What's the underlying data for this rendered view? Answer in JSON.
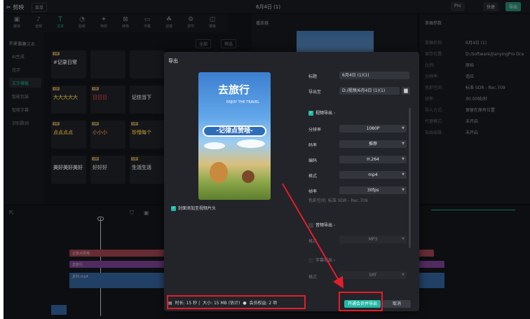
{
  "app": {
    "logo": "剪映",
    "menu_label": "菜单",
    "project_title": "6月4日 (1)",
    "pro_label": "Pro",
    "shortcut_label": "快捷",
    "export_label": "导出"
  },
  "media_tabs": [
    {
      "icon": "▣",
      "label": "媒体",
      "icon_name": "media-icon"
    },
    {
      "icon": "♪",
      "label": "音频",
      "icon_name": "audio-icon"
    },
    {
      "icon": "T",
      "label": "文本",
      "icon_name": "text-icon"
    },
    {
      "icon": "◔",
      "label": "贴纸",
      "icon_name": "sticker-icon"
    },
    {
      "icon": "✦",
      "label": "特效",
      "icon_name": "effect-icon"
    },
    {
      "icon": "⊠",
      "label": "转场",
      "icon_name": "transition-icon"
    },
    {
      "icon": "▭",
      "label": "字幕",
      "icon_name": "caption-icon"
    },
    {
      "icon": "☘",
      "label": "滤镜",
      "icon_name": "filter-icon"
    },
    {
      "icon": "⚙",
      "label": "调节",
      "icon_name": "adjust-icon"
    },
    {
      "icon": "◫",
      "label": "模板",
      "icon_name": "template-icon"
    }
  ],
  "categories": [
    "新建文本",
    "AI生成",
    "花字",
    "文字模板",
    "智能包装",
    "智能字幕",
    "识别歌词"
  ],
  "asset_panel": {
    "search": "< 新建文本",
    "filter_all": "全部",
    "filter_label": "筛选"
  },
  "assets": [
    {
      "text": "#记录日常",
      "color": "#e8eaee",
      "vip": "VIP"
    },
    {
      "text": "",
      "color": "#e8eaee",
      "vip": ""
    },
    {
      "text": "",
      "color": "#e8eaee",
      "vip": ""
    },
    {
      "text": "大大大大大",
      "color": "#f0d24a",
      "vip": "VIP"
    },
    {
      "text": "日日日",
      "color": "#f0424a",
      "vip": "VIP"
    },
    {
      "text": "记住当下",
      "color": "#e8eaee",
      "vip": ""
    },
    {
      "text": "点点点点",
      "color": "#f0c24a",
      "vip": "VIP"
    },
    {
      "text": "小小小",
      "color": "#f0904a",
      "vip": "VIP"
    },
    {
      "text": "珍惜每个",
      "color": "#f0c24a",
      "vip": "VIP"
    },
    {
      "text": "美好美好美好",
      "color": "#e8eaee",
      "vip": ""
    },
    {
      "text": "好好好",
      "color": "#d8d8d8",
      "vip": "VIP"
    },
    {
      "text": "生活生活",
      "color": "#e8eaee",
      "vip": "VIP"
    }
  ],
  "player": {
    "title": "播放器"
  },
  "props": {
    "title": "草稿参数",
    "rows": [
      {
        "k": "草稿名称:",
        "v": "6月4日 (1)"
      },
      {
        "k": "保存位置:",
        "v": "D:/Software/JianyingPro Dra"
      },
      {
        "k": "比例:",
        "v": "原始"
      },
      {
        "k": "分辨率:",
        "v": "适应"
      },
      {
        "k": "色彩空间:",
        "v": "标准 SDR - Rec.709"
      },
      {
        "k": "帧率:",
        "v": "30.00帧/秒"
      },
      {
        "k": "导入方式:",
        "v": "保留在原有位置"
      },
      {
        "k": "代理模式:",
        "v": "未开启"
      },
      {
        "k": "自由层级:",
        "v": "未开启"
      }
    ]
  },
  "timeline": {
    "tracks": [
      {
        "label": "记录点赞哦",
        "color": "#b24a58"
      },
      {
        "label": "去旅行",
        "color": "#8a4aa8"
      },
      {
        "label": "素材.mp4",
        "color": "#3a6fb0"
      }
    ]
  },
  "dialog": {
    "title": "导出",
    "cover": {
      "title_text": "去旅行",
      "subtitle_text": "ENJOY THE TRAVEL",
      "banner_text": "-记律点赞哦-"
    },
    "cover_checkbox_label": "封面添加至视频片头",
    "fields": {
      "name_label": "标题",
      "name_value": "6月4日 (1)(1)",
      "path_label": "导出至",
      "path_value": "D:/视频/6月4日 (1)(1)"
    },
    "video_section": "视频导出",
    "video_rows": [
      {
        "label": "分辨率",
        "value": "1080P"
      },
      {
        "label": "码率",
        "value": "推荐"
      },
      {
        "label": "编码",
        "value": "H.264"
      },
      {
        "label": "格式",
        "value": "mp4"
      },
      {
        "label": "帧率",
        "value": "30fps"
      }
    ],
    "color_space": "色彩空间: 标准 SDR - Rec.709",
    "audio_section": "音频导出",
    "audio_rows": [
      {
        "label": "格式",
        "value": "MP3"
      }
    ],
    "caption_section": "字幕导出",
    "caption_rows": [
      {
        "label": "格式",
        "value": "SRT"
      }
    ],
    "footer": {
      "duration": "时长: 15 秒",
      "size": "大小: 15 MB (估计)",
      "vip": "会员权益: 2 项"
    },
    "btn_export": "开通会员并导出",
    "btn_cancel": "取消"
  },
  "colors": {
    "accent": "#23b8a4",
    "annotation": "#e31d2b",
    "dialog_bg": "#232429"
  }
}
